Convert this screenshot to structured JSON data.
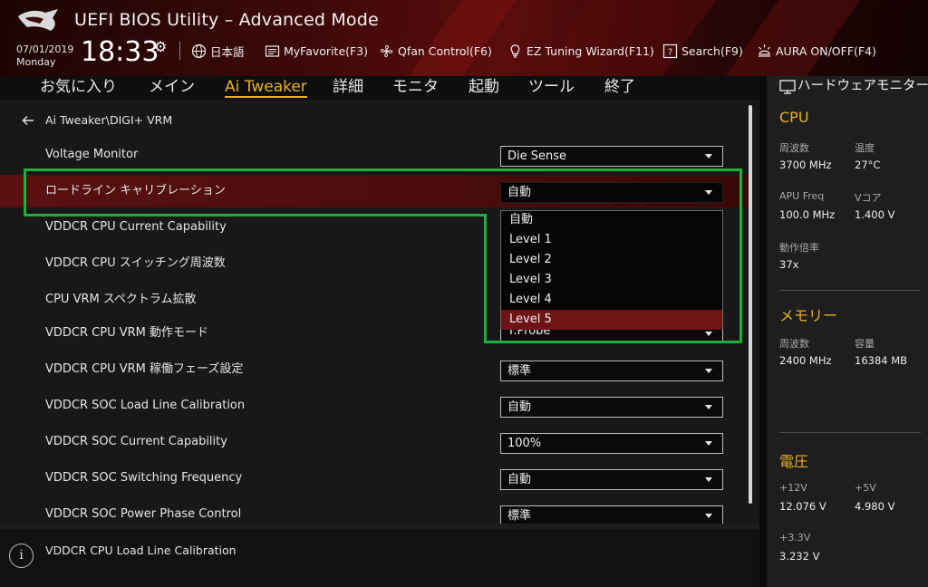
{
  "header": {
    "title": "UEFI BIOS Utility – Advanced Mode",
    "date": "07/01/2019",
    "day": "Monday",
    "time": "18:33",
    "toolbar": [
      {
        "name": "language",
        "icon": "globe-icon",
        "label": "日本語"
      },
      {
        "name": "my-favorite",
        "icon": "favorite-icon",
        "label": "MyFavorite(F3)"
      },
      {
        "name": "qfan-control",
        "icon": "fan-icon",
        "label": "Qfan Control(F6)"
      },
      {
        "name": "ez-tuning-wizard",
        "icon": "lightbulb-icon",
        "label": "EZ Tuning Wizard(F11)"
      },
      {
        "name": "search",
        "icon": "search-box-icon",
        "label": "Search(F9)"
      },
      {
        "name": "aura",
        "icon": "aura-icon",
        "label": "AURA ON/OFF(F4)"
      }
    ]
  },
  "tabs": [
    {
      "label": "お気に入り",
      "active": false
    },
    {
      "label": "メイン",
      "active": false
    },
    {
      "label": "Ai Tweaker",
      "active": true
    },
    {
      "label": "詳細",
      "active": false
    },
    {
      "label": "モニタ",
      "active": false
    },
    {
      "label": "起動",
      "active": false
    },
    {
      "label": "ツール",
      "active": false
    },
    {
      "label": "終了",
      "active": false
    }
  ],
  "breadcrumb": "Ai Tweaker\\DIGI+ VRM",
  "settings": [
    {
      "label": "Voltage Monitor",
      "value": "Die Sense"
    },
    {
      "label": "ロードライン キャリブレーション",
      "value": "自動",
      "selected": true
    },
    {
      "label": "VDDCR CPU Current Capability",
      "value": ""
    },
    {
      "label": "VDDCR CPU スイッチング周波数",
      "value": ""
    },
    {
      "label": "CPU VRM スペクトラム拡散",
      "value": ""
    },
    {
      "label": "VDDCR CPU VRM 動作モード",
      "value": "T.Probe"
    },
    {
      "label": "VDDCR CPU VRM 稼働フェーズ設定",
      "value": "標準"
    },
    {
      "label": "VDDCR SOC Load Line Calibration",
      "value": "自動"
    },
    {
      "label": "VDDCR SOC Current Capability",
      "value": "100%"
    },
    {
      "label": "VDDCR SOC Switching Frequency",
      "value": "自動"
    },
    {
      "label": "VDDCR SOC Power Phase Control",
      "value": "標準"
    }
  ],
  "dropdown": {
    "options": [
      "自動",
      "Level 1",
      "Level 2",
      "Level 3",
      "Level 4",
      "Level 5"
    ],
    "highlighted": "Level 5"
  },
  "help": {
    "text": "VDDCR CPU Load Line Calibration"
  },
  "monitor": {
    "title": "ハードウェアモニター",
    "cpu": {
      "title": "CPU",
      "freq_label": "周波数",
      "freq_value": "3700 MHz",
      "temp_label": "温度",
      "temp_value": "27°C",
      "apu_label": "APU Freq",
      "apu_value": "100.0 MHz",
      "vcore_label": "Vコア",
      "vcore_value": "1.400 V",
      "ratio_label": "動作倍率",
      "ratio_value": "37x"
    },
    "memory": {
      "title": "メモリー",
      "freq_label": "周波数",
      "freq_value": "2400 MHz",
      "cap_label": "容量",
      "cap_value": "16384 MB"
    },
    "voltage": {
      "title": "電圧",
      "v12_label": "+12V",
      "v12_value": "12.076 V",
      "v5_label": "+5V",
      "v5_value": "4.980 V",
      "v33_label": "+3.3V",
      "v33_value": "3.232 V"
    }
  },
  "colors": {
    "accent": "#e8b020",
    "selected_row": "#5a1010",
    "highlight_box": "#1fae3e"
  }
}
